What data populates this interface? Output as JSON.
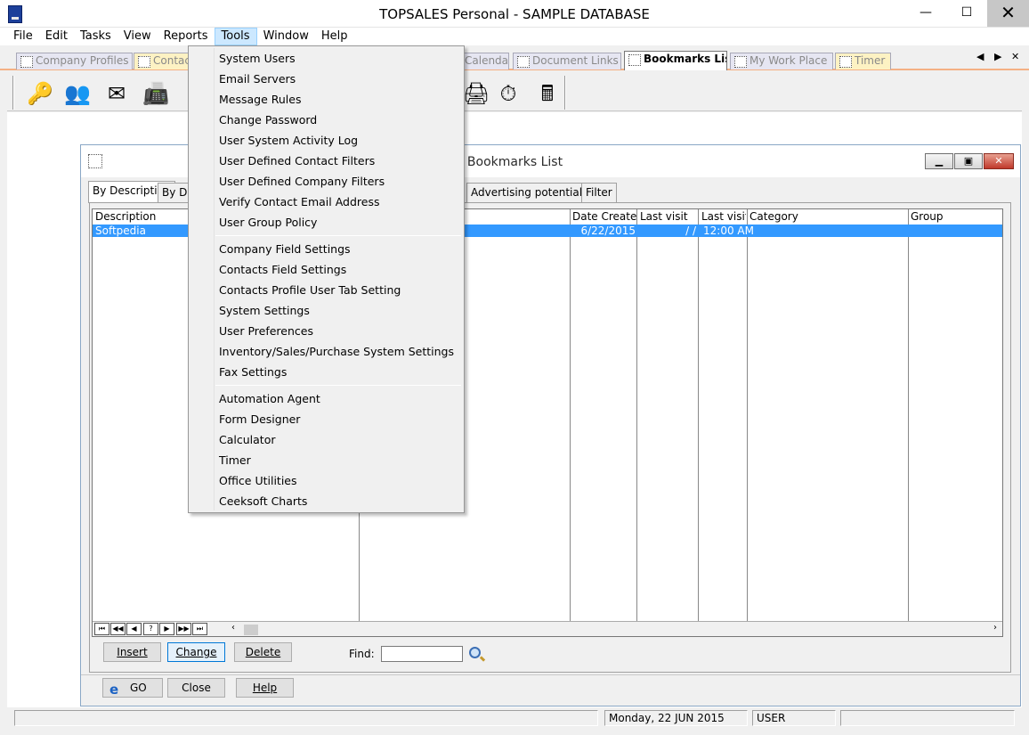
{
  "window": {
    "title": "TOPSALES Personal - SAMPLE DATABASE",
    "minimize": "—",
    "maximize": "☐",
    "close": "✕"
  },
  "menu": [
    "File",
    "Edit",
    "Tasks",
    "View",
    "Reports",
    "Tools",
    "Window",
    "Help"
  ],
  "top_tabs": [
    "Company Profiles",
    "Contacts",
    "Calendar",
    "Document Links",
    "Bookmarks List",
    "My Work Place",
    "Timer"
  ],
  "tab_nav": {
    "prev": "◀",
    "next": "▶",
    "close": "✕"
  },
  "child_window": {
    "title": "Bookmarks List",
    "tabs": [
      "By Description",
      "By Date",
      "Advertising potential rank",
      "Filter"
    ],
    "columns": [
      "Description",
      "Date Created",
      "Last visit",
      "Last visit ti",
      "Category",
      "Group"
    ],
    "rows": [
      {
        "description": "Softpedia",
        "date_created": "6/22/2015",
        "last_visit": "/  /",
        "last_visit_time": "12:00 AM",
        "category": "",
        "group": ""
      }
    ],
    "navigator": [
      "⏮",
      "◀◀",
      "◀",
      "?",
      "▶",
      "▶▶",
      "⏭"
    ],
    "buttons": {
      "insert": "Insert",
      "change": "Change",
      "delete": "Delete",
      "find_label": "Find:",
      "go": "GO",
      "close": "Close",
      "help": "Help"
    }
  },
  "tools_menu": {
    "group1": [
      "System Users",
      "Email Servers",
      "Message Rules",
      "Change Password",
      "User System Activity Log",
      "User Defined Contact Filters",
      "User Defined Company Filters",
      "Verify Contact Email Address",
      "User Group Policy"
    ],
    "group2": [
      "Company Field Settings",
      "Contacts Field Settings",
      "Contacts Profile User Tab Setting",
      "System Settings",
      "User Preferences",
      "Inventory/Sales/Purchase System Settings",
      "Fax Settings"
    ],
    "group3": [
      "Automation Agent",
      "Form Designer",
      "Calculator",
      "Timer",
      "Office Utilities",
      "Ceeksoft Charts"
    ]
  },
  "status": {
    "date": "Monday, 22 JUN 2015",
    "user": "USER"
  }
}
